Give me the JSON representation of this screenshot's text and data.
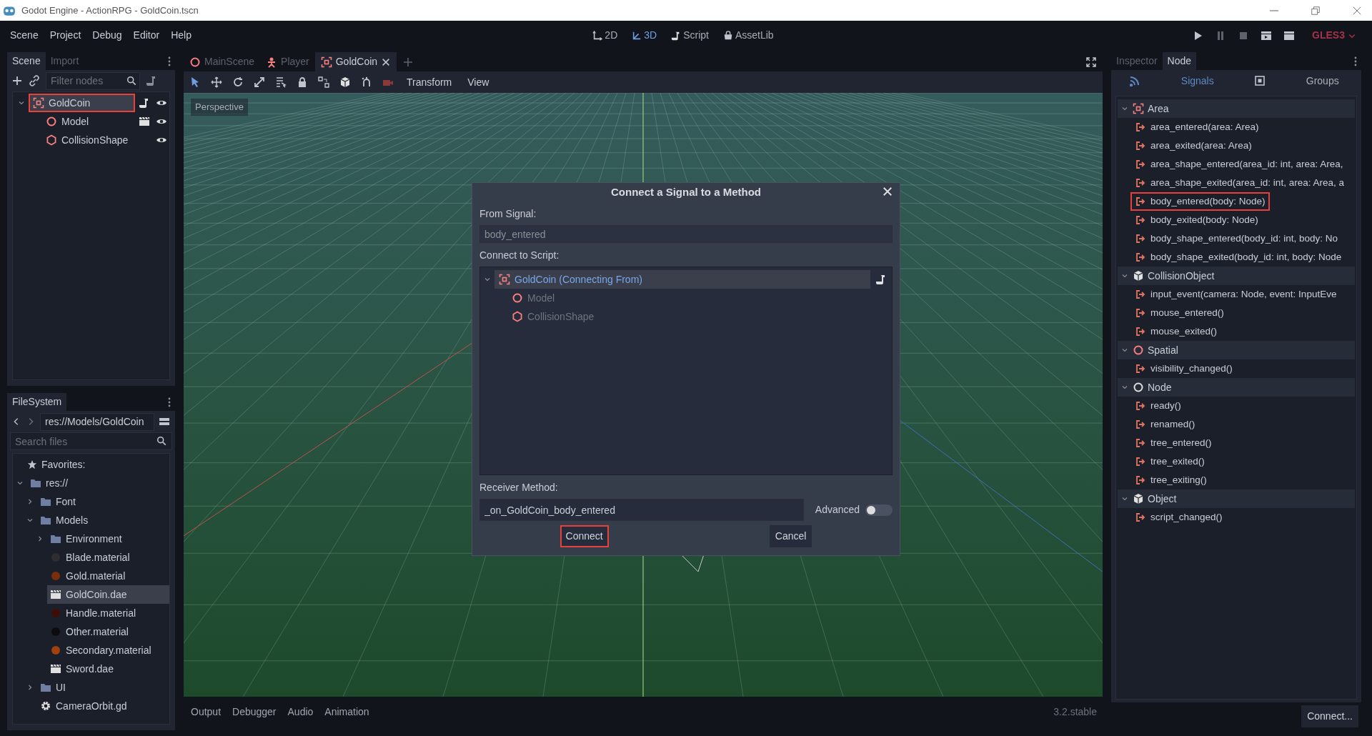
{
  "window": {
    "title": "Godot Engine - ActionRPG - GoldCoin.tscn"
  },
  "menu_bar": {
    "menus": [
      "Scene",
      "Project",
      "Debug",
      "Editor",
      "Help"
    ],
    "workspaces": [
      {
        "label": "2D",
        "kind": "twod",
        "selected": false
      },
      {
        "label": "3D",
        "kind": "threed",
        "selected": true
      },
      {
        "label": "Script",
        "kind": "script",
        "selected": false
      },
      {
        "label": "AssetLib",
        "kind": "assetlib",
        "selected": false
      }
    ],
    "renderer": "GLES3"
  },
  "scene_dock": {
    "tabs": [
      {
        "label": "Scene",
        "selected": true
      },
      {
        "label": "Import",
        "selected": false
      }
    ],
    "filter_placeholder": "Filter nodes",
    "tree": [
      {
        "label": "GoldCoin",
        "kind": "area",
        "expanded": true,
        "selected": true,
        "highlighted": true,
        "script": true,
        "instanced": false,
        "visible": true,
        "children": [
          {
            "label": "Model",
            "kind": "spatial",
            "selected": false,
            "highlighted": false,
            "script": false,
            "instanced": true,
            "visible": true
          },
          {
            "label": "CollisionShape",
            "kind": "collision",
            "selected": false,
            "highlighted": false,
            "script": false,
            "instanced": false,
            "visible": true
          }
        ]
      }
    ]
  },
  "filesystem_dock": {
    "tab": "FileSystem",
    "path": "res://Models/GoldCoin",
    "search_placeholder": "Search files",
    "favorites": "Favorites:",
    "tree": [
      {
        "label": "res://",
        "kind": "folder",
        "expanded": true,
        "selected": false,
        "children": [
          {
            "label": "Font",
            "kind": "folder",
            "expanded": false,
            "selected": false
          },
          {
            "label": "Models",
            "kind": "folder",
            "expanded": true,
            "selected": false,
            "children": [
              {
                "label": "Environment",
                "kind": "folder",
                "expanded": false,
                "selected": false
              },
              {
                "label": "Blade.material",
                "kind": "material",
                "color": "#2e2e2e",
                "selected": false
              },
              {
                "label": "Gold.material",
                "kind": "material",
                "color": "#7a2e0c",
                "selected": false
              },
              {
                "label": "GoldCoin.dae",
                "kind": "scene",
                "selected": true
              },
              {
                "label": "Handle.material",
                "kind": "material",
                "color": "#3e0e06",
                "selected": false
              },
              {
                "label": "Other.material",
                "kind": "material",
                "color": "#0c0c0c",
                "selected": false
              },
              {
                "label": "Secondary.material",
                "kind": "material",
                "color": "#a3400e",
                "selected": false
              },
              {
                "label": "Sword.dae",
                "kind": "scene",
                "selected": false
              }
            ]
          },
          {
            "label": "UI",
            "kind": "folder",
            "expanded": false,
            "selected": false
          },
          {
            "label": "CameraOrbit.gd",
            "kind": "script",
            "selected": false
          }
        ]
      }
    ]
  },
  "editor": {
    "tabs": [
      {
        "label": "MainScene",
        "kind": "spatial",
        "selected": false
      },
      {
        "label": "Player",
        "kind": "kinematic",
        "selected": false
      },
      {
        "label": "GoldCoin",
        "kind": "area",
        "selected": true
      }
    ],
    "toolbar_menus": [
      "Transform",
      "View"
    ],
    "viewport_label": "Perspective",
    "bottom_tabs": [
      "Output",
      "Debugger",
      "Audio",
      "Animation"
    ],
    "version": "3.2.stable"
  },
  "node_dock": {
    "tabs": [
      {
        "label": "Inspector",
        "selected": false
      },
      {
        "label": "Node",
        "selected": true
      }
    ],
    "subtabs": [
      {
        "label": "Signals",
        "kind": "signals",
        "selected": true
      },
      {
        "label": "Groups",
        "kind": "groups",
        "selected": false
      }
    ],
    "groups": [
      {
        "label": "Area",
        "kind": "area",
        "expanded": true,
        "signals": [
          {
            "label": "area_entered(area: Area)",
            "highlighted": false
          },
          {
            "label": "area_exited(area: Area)",
            "highlighted": false
          },
          {
            "label": "area_shape_entered(area_id: int, area: Area,",
            "highlighted": false
          },
          {
            "label": "area_shape_exited(area_id: int, area: Area, a",
            "highlighted": false
          },
          {
            "label": "body_entered(body: Node)",
            "highlighted": true
          },
          {
            "label": "body_exited(body: Node)",
            "highlighted": false
          },
          {
            "label": "body_shape_entered(body_id: int, body: No",
            "highlighted": false
          },
          {
            "label": "body_shape_exited(body_id: int, body: Node",
            "highlighted": false
          }
        ]
      },
      {
        "label": "CollisionObject",
        "kind": "object",
        "expanded": true,
        "signals": [
          {
            "label": "input_event(camera: Node, event: InputEve",
            "highlighted": false
          },
          {
            "label": "mouse_entered()",
            "highlighted": false
          },
          {
            "label": "mouse_exited()",
            "highlighted": false
          }
        ]
      },
      {
        "label": "Spatial",
        "kind": "spatial",
        "expanded": true,
        "signals": [
          {
            "label": "visibility_changed()",
            "highlighted": false
          }
        ]
      },
      {
        "label": "Node",
        "kind": "node",
        "expanded": true,
        "signals": [
          {
            "label": "ready()",
            "highlighted": false
          },
          {
            "label": "renamed()",
            "highlighted": false
          },
          {
            "label": "tree_entered()",
            "highlighted": false
          },
          {
            "label": "tree_exited()",
            "highlighted": false
          },
          {
            "label": "tree_exiting()",
            "highlighted": false
          }
        ]
      },
      {
        "label": "Object",
        "kind": "object",
        "expanded": true,
        "signals": [
          {
            "label": "script_changed()",
            "highlighted": false
          }
        ]
      }
    ],
    "connect_button": "Connect..."
  },
  "dialog": {
    "title": "Connect a Signal to a Method",
    "from_signal_label": "From Signal:",
    "from_signal_value": "body_entered",
    "connect_to_label": "Connect to Script:",
    "tree": [
      {
        "label": "GoldCoin (Connecting From)",
        "kind": "area",
        "expanded": true,
        "selected": true,
        "disabled": false,
        "script": true,
        "children": [
          {
            "label": "Model",
            "kind": "spatial",
            "selected": false,
            "disabled": true,
            "script": false
          },
          {
            "label": "CollisionShape",
            "kind": "collision",
            "selected": false,
            "disabled": true,
            "script": false
          }
        ]
      }
    ],
    "receiver_label": "Receiver Method:",
    "receiver_value": "_on_GoldCoin_body_entered",
    "advanced": {
      "label": "Advanced",
      "on": false
    },
    "buttons": [
      {
        "label": "Connect",
        "highlighted": true
      },
      {
        "label": "Cancel",
        "highlighted": false
      }
    ]
  }
}
